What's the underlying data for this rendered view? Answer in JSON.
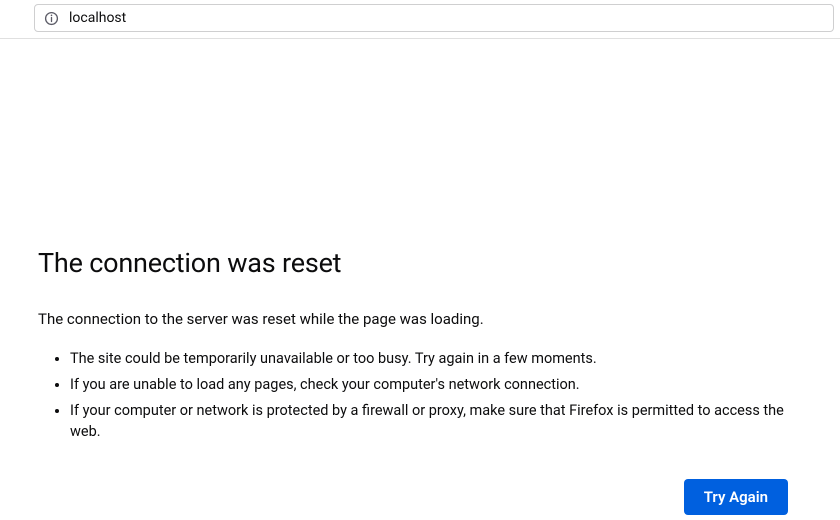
{
  "addressBar": {
    "url": "localhost"
  },
  "error": {
    "title": "The connection was reset",
    "subtitle": "The connection to the server was reset while the page was loading.",
    "bullets": [
      "The site could be temporarily unavailable or too busy. Try again in a few moments.",
      "If you are unable to load any pages, check your computer's network connection.",
      "If your computer or network is protected by a firewall or proxy, make sure that Firefox is permitted to access the web."
    ],
    "tryAgainLabel": "Try Again"
  }
}
